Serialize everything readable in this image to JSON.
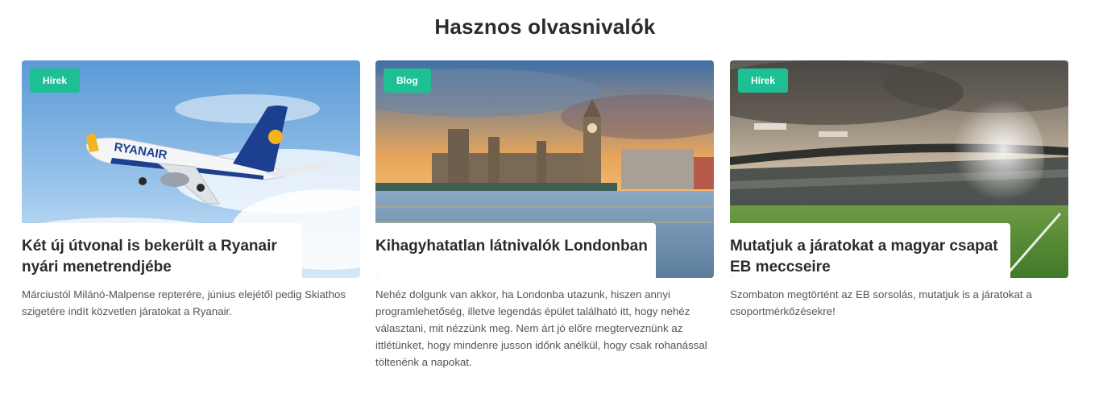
{
  "section": {
    "title": "Hasznos olvasnivalók"
  },
  "colors": {
    "badge": "#1fbf95",
    "title": "#2b2b2b",
    "excerpt": "#555555"
  },
  "cards": [
    {
      "badge": "Hírek",
      "title": "Két új útvonal is bekerült a Ryanair nyári menetrendjébe",
      "excerpt": "Márciustól Milánó-Malpense repterére, június elejétől pedig Skiathos szigetére indít közvetlen járatokat a Ryanair.",
      "image_text": "RYANAIR"
    },
    {
      "badge": "Blog",
      "title": "Kihagyhatatlan látnivalók Londonban",
      "excerpt": "Nehéz dolgunk van akkor, ha Londonba utazunk, hiszen annyi programlehetőség, illetve legendás épület található itt, hogy nehéz választani, mit nézzünk meg. Nem árt jó előre megterveznünk az ittlétünket, hogy mindenre jusson időnk anélkül, hogy csak rohanással töltenénk a napokat."
    },
    {
      "badge": "Hírek",
      "title": "Mutatjuk a járatokat a magyar csapat EB meccseire",
      "excerpt": "Szombaton megtörtént az EB sorsolás, mutatjuk is a járatokat a csoportmérkőzésekre!"
    }
  ]
}
